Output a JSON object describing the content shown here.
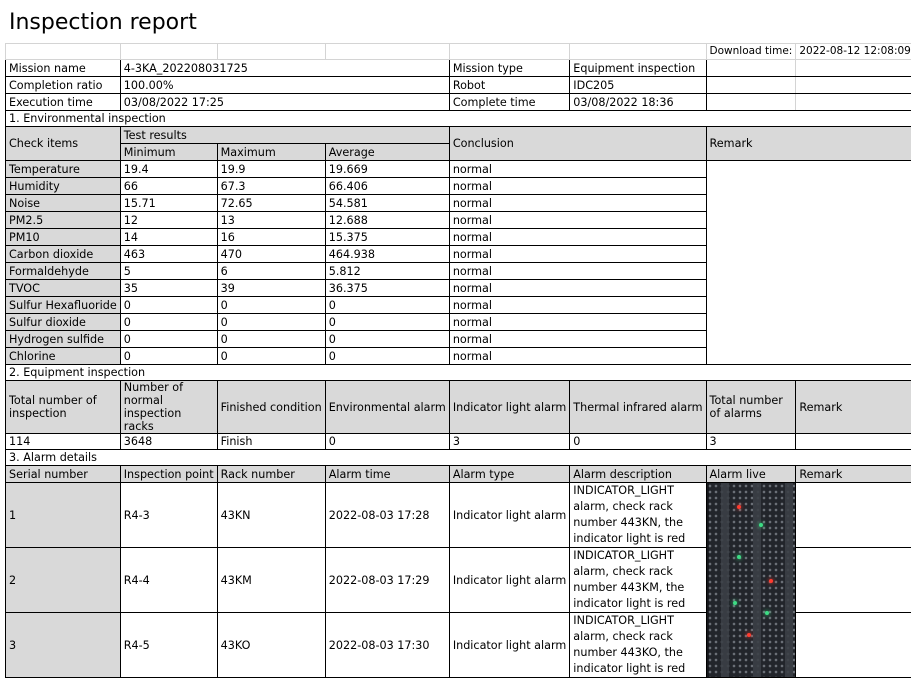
{
  "report": {
    "title": "Inspection report",
    "download_label": "Download time:",
    "download_time": "2022-08-12 12:08:09"
  },
  "mission": {
    "name_label": "Mission name",
    "name_value": "4-3KA_202208031725",
    "type_label": "Mission type",
    "type_value": "Equipment inspection",
    "completion_label": "Completion ratio",
    "completion_value": "100.00%",
    "robot_label": "Robot",
    "robot_value": "IDC205",
    "execution_label": "Execution time",
    "execution_value": "03/08/2022 17:25",
    "complete_label": "Complete time",
    "complete_value": "03/08/2022 18:36"
  },
  "env": {
    "section_title": "1. Environmental inspection",
    "check_items_label": "Check items",
    "test_results_label": "Test results",
    "min_label": "Minimum",
    "max_label": "Maximum",
    "avg_label": "Average",
    "conclusion_label": "Conclusion",
    "remark_label": "Remark",
    "rows": [
      {
        "item": "Temperature",
        "min": "19.4",
        "max": "19.9",
        "avg": "19.669",
        "conclusion": "normal"
      },
      {
        "item": "Humidity",
        "min": "66",
        "max": "67.3",
        "avg": "66.406",
        "conclusion": "normal"
      },
      {
        "item": "Noise",
        "min": "15.71",
        "max": "72.65",
        "avg": "54.581",
        "conclusion": "normal"
      },
      {
        "item": "PM2.5",
        "min": "12",
        "max": "13",
        "avg": "12.688",
        "conclusion": "normal"
      },
      {
        "item": "PM10",
        "min": "14",
        "max": "16",
        "avg": "15.375",
        "conclusion": "normal"
      },
      {
        "item": "Carbon dioxide",
        "min": "463",
        "max": "470",
        "avg": "464.938",
        "conclusion": "normal"
      },
      {
        "item": "Formaldehyde",
        "min": "5",
        "max": "6",
        "avg": "5.812",
        "conclusion": "normal"
      },
      {
        "item": "TVOC",
        "min": "35",
        "max": "39",
        "avg": "36.375",
        "conclusion": "normal"
      },
      {
        "item": "Sulfur Hexafluoride",
        "min": "0",
        "max": "0",
        "avg": "0",
        "conclusion": "normal"
      },
      {
        "item": "Sulfur dioxide",
        "min": "0",
        "max": "0",
        "avg": "0",
        "conclusion": "normal"
      },
      {
        "item": "Hydrogen sulfide",
        "min": "0",
        "max": "0",
        "avg": "0",
        "conclusion": "normal"
      },
      {
        "item": "Chlorine",
        "min": "0",
        "max": "0",
        "avg": "0",
        "conclusion": "normal"
      }
    ]
  },
  "equip": {
    "section_title": "2. Equipment inspection",
    "headers": {
      "total": "Total number of inspection",
      "normal": "Number of normal inspection racks",
      "finished": "Finished condition",
      "environmental": "Environmental alarm",
      "indicator": "Indicator light alarm",
      "thermal": "Thermal infrared alarm",
      "alarms": "Total number of alarms",
      "remark": "Remark"
    },
    "values": {
      "total": "114",
      "normal": "3648",
      "finished": "Finish",
      "environmental": "0",
      "indicator": "3",
      "thermal": "0",
      "alarms": "3",
      "remark": ""
    }
  },
  "alarm": {
    "section_title": "3. Alarm details",
    "headers": {
      "serial": "Serial number",
      "point": "Inspection point",
      "rack": "Rack number",
      "time": "Alarm time",
      "type": "Alarm type",
      "desc": "Alarm description",
      "live": "Alarm live",
      "remark": "Remark"
    },
    "rows": [
      {
        "serial": "1",
        "point": "R4-3",
        "rack": "43KN",
        "time": "2022-08-03 17:28",
        "type": "Indicator light alarm",
        "desc": "INDICATOR_LIGHT alarm, check rack number 443KN, the indicator light is red"
      },
      {
        "serial": "2",
        "point": "R4-4",
        "rack": "43KM",
        "time": "2022-08-03 17:29",
        "type": "Indicator light alarm",
        "desc": "INDICATOR_LIGHT alarm, check rack number 443KM, the indicator light is red"
      },
      {
        "serial": "3",
        "point": "R4-5",
        "rack": "43KO",
        "time": "2022-08-03 17:30",
        "type": "Indicator light alarm",
        "desc": "INDICATOR_LIGHT alarm, check rack number 443KO, the indicator light is red"
      }
    ]
  }
}
